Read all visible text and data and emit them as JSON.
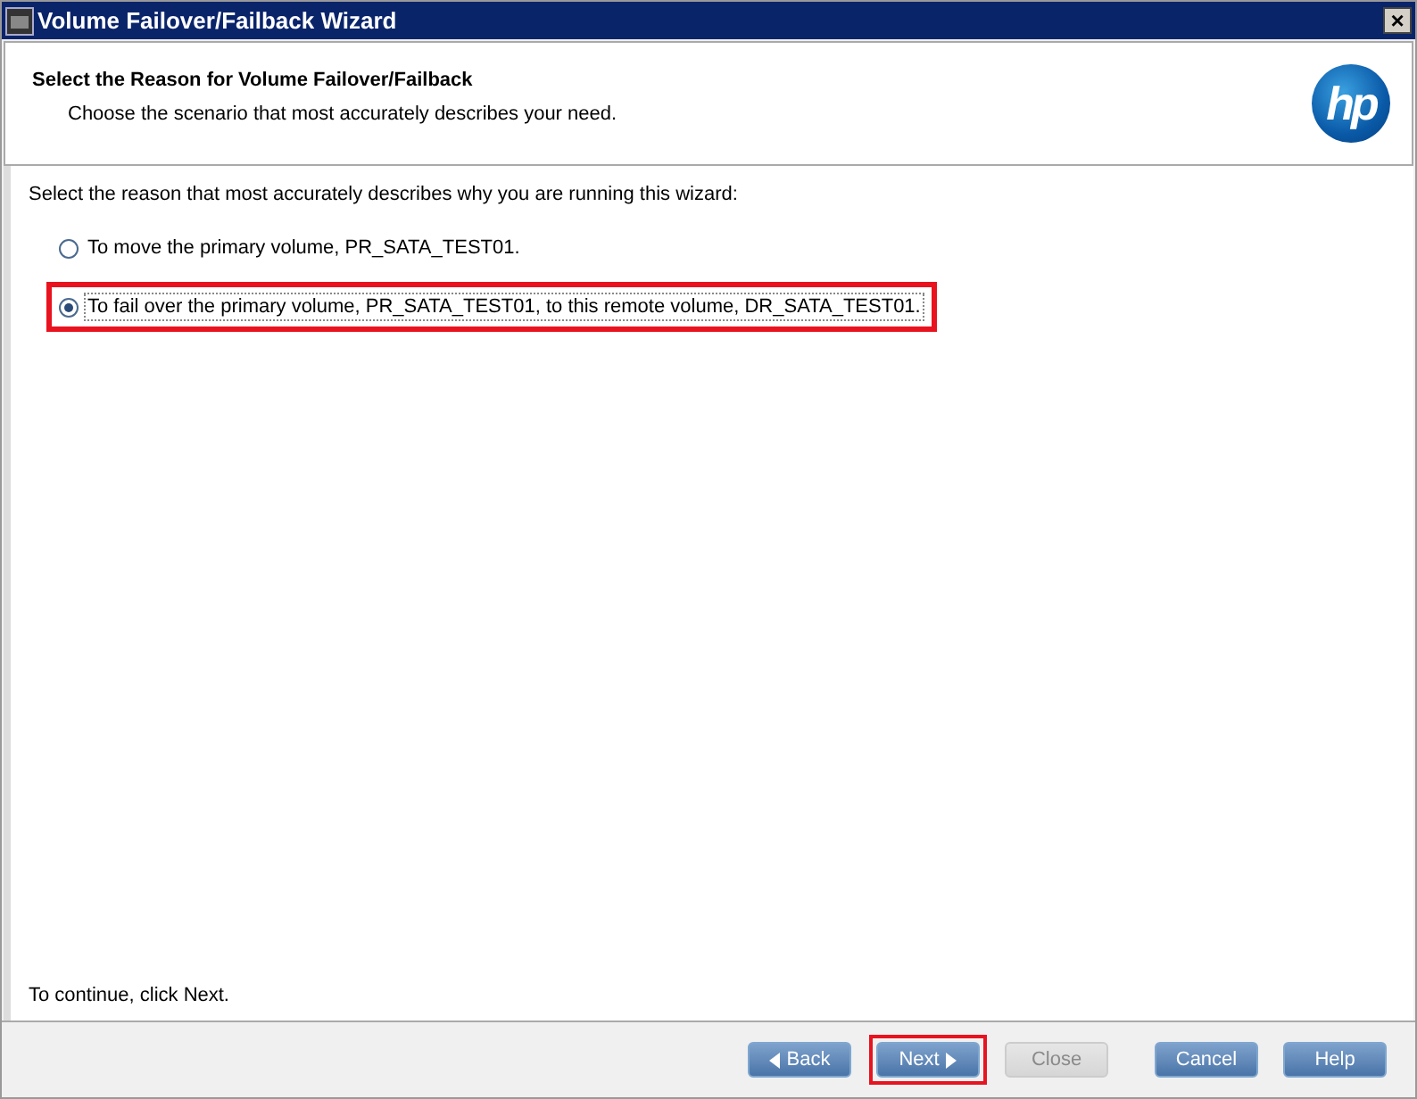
{
  "window": {
    "title": "Volume Failover/Failback Wizard",
    "close": "×"
  },
  "header": {
    "title": "Select the Reason for Volume Failover/Failback",
    "subtitle": "Choose the scenario that most accurately describes your need.",
    "logo": "hp"
  },
  "prompt": "Select the reason that most accurately describes why you are running this wizard:",
  "options": [
    {
      "label": "To move the primary volume, PR_SATA_TEST01.",
      "selected": false,
      "highlighted": false
    },
    {
      "label": "To fail over the primary volume, PR_SATA_TEST01, to this remote volume, DR_SATA_TEST01.",
      "selected": true,
      "highlighted": true
    }
  ],
  "footer_hint": "To continue, click Next.",
  "buttons": [
    {
      "label": "Back",
      "kind": "back",
      "disabled": false,
      "highlighted": false
    },
    {
      "label": "Next",
      "kind": "next",
      "disabled": false,
      "highlighted": true
    },
    {
      "label": "Close",
      "kind": "plain",
      "disabled": true,
      "highlighted": false
    },
    {
      "label": "Cancel",
      "kind": "plain",
      "disabled": false,
      "highlighted": false
    },
    {
      "label": "Help",
      "kind": "plain",
      "disabled": false,
      "highlighted": false
    }
  ]
}
